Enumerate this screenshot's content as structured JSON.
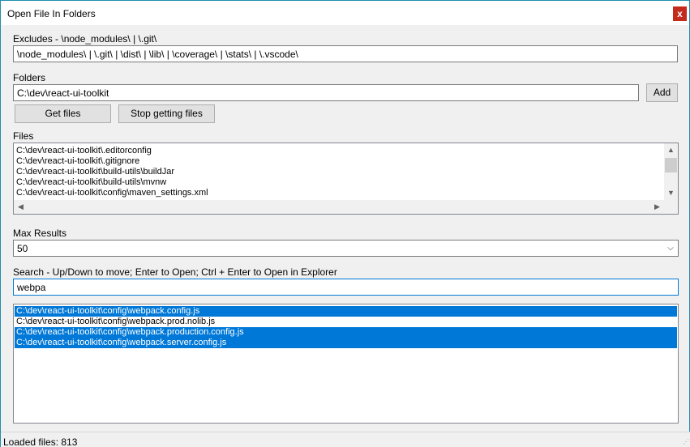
{
  "window": {
    "title": "Open File In Folders",
    "close_glyph": "x"
  },
  "excludes": {
    "label": "Excludes - \\node_modules\\ | \\.git\\",
    "value": "\\node_modules\\ | \\.git\\ | \\dist\\ | \\lib\\ | \\coverage\\ | \\stats\\ | \\.vscode\\"
  },
  "folders": {
    "label": "Folders",
    "value": "C:\\dev\\react-ui-toolkit",
    "add_label": "Add"
  },
  "actions": {
    "get_files_label": "Get files",
    "stop_label": "Stop getting files"
  },
  "files": {
    "label": "Files",
    "items": [
      "C:\\dev\\react-ui-toolkit\\.editorconfig",
      "C:\\dev\\react-ui-toolkit\\.gitignore",
      "C:\\dev\\react-ui-toolkit\\build-utils\\buildJar",
      "C:\\dev\\react-ui-toolkit\\build-utils\\mvnw",
      "C:\\dev\\react-ui-toolkit\\config\\maven_settings.xml"
    ]
  },
  "max_results": {
    "label": "Max Results",
    "value": "50"
  },
  "search": {
    "label": "Search - Up/Down to move; Enter to Open; Ctrl + Enter to Open in Explorer",
    "value": "webpa"
  },
  "results": {
    "items": [
      {
        "text": "C:\\dev\\react-ui-toolkit\\config\\webpack.config.js",
        "selected": true
      },
      {
        "text": "C:\\dev\\react-ui-toolkit\\config\\webpack.prod.nolib.js",
        "selected": false
      },
      {
        "text": "C:\\dev\\react-ui-toolkit\\config\\webpack.production.config.js",
        "selected": true
      },
      {
        "text": "C:\\dev\\react-ui-toolkit\\config\\webpack.server.config.js",
        "selected": true
      }
    ]
  },
  "status": {
    "text": "Loaded files: 813"
  },
  "icons": {
    "up": "▲",
    "down": "▼",
    "left": "◀",
    "right": "▶",
    "combo": "⌵",
    "grip": "⋰"
  },
  "colors": {
    "selection": "#0078d7",
    "title_border": "#1e8fb0",
    "close": "#c42b1c"
  }
}
